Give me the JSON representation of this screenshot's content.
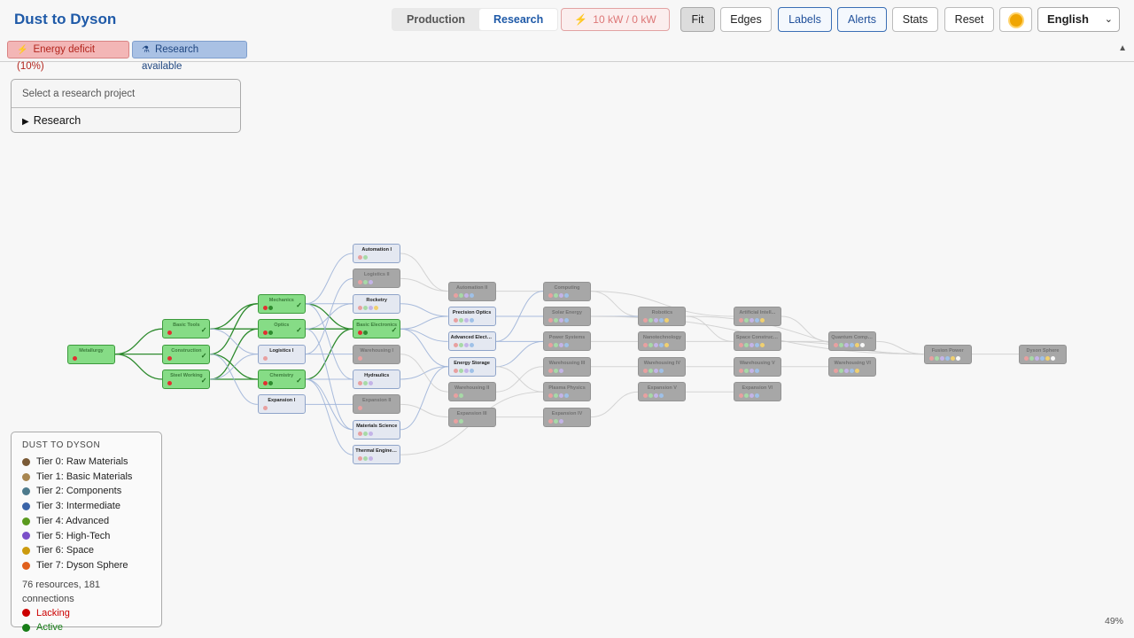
{
  "app": {
    "title": "Dust to Dyson"
  },
  "view_tabs": [
    {
      "label": "Production",
      "active": false
    },
    {
      "label": "Research",
      "active": true
    }
  ],
  "power": {
    "label": "10 kW / 0 kW"
  },
  "toolbar": {
    "fit": "Fit",
    "edges": "Edges",
    "labels": "Labels",
    "alerts": "Alerts",
    "stats": "Stats",
    "reset": "Reset"
  },
  "language": {
    "selected": "English"
  },
  "alerts": {
    "deficit": "Energy deficit (10%)",
    "research": "Research available"
  },
  "research_panel": {
    "placeholder": "Select a research project",
    "summary": "Research"
  },
  "legend": {
    "title": "DUST TO DYSON",
    "tiers": [
      {
        "label": "Tier 0: Raw Materials",
        "color": "#7a5a36"
      },
      {
        "label": "Tier 1: Basic Materials",
        "color": "#a88650"
      },
      {
        "label": "Tier 2: Components",
        "color": "#4d7a8c"
      },
      {
        "label": "Tier 3: Intermediate",
        "color": "#3a64a8"
      },
      {
        "label": "Tier 4: Advanced",
        "color": "#5a9a1e"
      },
      {
        "label": "Tier 5: High-Tech",
        "color": "#7b4fc9"
      },
      {
        "label": "Tier 6: Space",
        "color": "#cc9a0e"
      },
      {
        "label": "Tier 7: Dyson Sphere",
        "color": "#e0601c"
      }
    ],
    "stats": "76 resources, 181 connections",
    "lacking": {
      "label": "Lacking",
      "color": "#cc0000"
    },
    "active": {
      "label": "Active",
      "color": "#177d17"
    }
  },
  "zoom": "49%",
  "colors": {
    "accent": "#1f5aa8",
    "active_node": "#86dc86",
    "locked_node": "#a7a7a7",
    "available_node": "#e4e8f1"
  },
  "nodes": [
    {
      "id": "metallurgy",
      "label": "Metallurgy",
      "state": "active",
      "col": 0,
      "row": 4.0,
      "dots": [
        "#e03030"
      ],
      "check": false
    },
    {
      "id": "basic-tools",
      "label": "Basic Tools",
      "state": "active",
      "col": 1,
      "row": 3.0,
      "dots": [
        "#e03030"
      ],
      "check": true
    },
    {
      "id": "construction",
      "label": "Construction",
      "state": "active",
      "col": 1,
      "row": 4.0,
      "dots": [
        "#e03030"
      ],
      "check": true
    },
    {
      "id": "steel-working",
      "label": "Steel Working",
      "state": "active",
      "col": 1,
      "row": 5.0,
      "dots": [
        "#e03030"
      ],
      "check": true
    },
    {
      "id": "mechanics",
      "label": "Mechanics",
      "state": "active",
      "col": 2,
      "row": 2.0,
      "dots": [
        "#e03030",
        "#2e8b2e"
      ],
      "check": true
    },
    {
      "id": "optics",
      "label": "Optics",
      "state": "active",
      "col": 2,
      "row": 3.0,
      "dots": [
        "#e03030",
        "#2e8b2e"
      ],
      "check": true
    },
    {
      "id": "logistics-1",
      "label": "Logistics I",
      "state": "available",
      "col": 2,
      "row": 4.0,
      "dots": [
        "#e8a0a0"
      ],
      "check": false
    },
    {
      "id": "chemistry",
      "label": "Chemistry",
      "state": "active",
      "col": 2,
      "row": 5.0,
      "dots": [
        "#e03030",
        "#2e8b2e"
      ],
      "check": true
    },
    {
      "id": "expansion-1",
      "label": "Expansion I",
      "state": "available",
      "col": 2,
      "row": 6.0,
      "dots": [
        "#e8a0a0"
      ],
      "check": false
    },
    {
      "id": "automation-1",
      "label": "Automation I",
      "state": "available",
      "col": 3,
      "row": 0.0,
      "dots": [
        "#e8a0a0",
        "#a7d9a7"
      ],
      "check": false
    },
    {
      "id": "logistics-2",
      "label": "Logistics II",
      "state": "locked",
      "col": 3,
      "row": 1.0,
      "dots": [
        "#e8a0a0",
        "#a7d9a7",
        "#c4b4e8"
      ],
      "check": false
    },
    {
      "id": "rocketry",
      "label": "Rocketry",
      "state": "available",
      "col": 3,
      "row": 2.0,
      "dots": [
        "#e8a0a0",
        "#a7d9a7",
        "#c4b4e8",
        "#f0d070"
      ],
      "check": false
    },
    {
      "id": "basic-electronics",
      "label": "Basic Electronics",
      "state": "active",
      "col": 3,
      "row": 3.0,
      "dots": [
        "#e03030",
        "#2e8b2e"
      ],
      "check": true
    },
    {
      "id": "warehousing-1",
      "label": "Warehousing I",
      "state": "locked",
      "col": 3,
      "row": 4.0,
      "dots": [
        "#e8a0a0"
      ],
      "check": false
    },
    {
      "id": "hydraulics",
      "label": "Hydraulics",
      "state": "available",
      "col": 3,
      "row": 5.0,
      "dots": [
        "#e8a0a0",
        "#a7d9a7",
        "#c4b4e8"
      ],
      "check": false
    },
    {
      "id": "expansion-2",
      "label": "Expansion II",
      "state": "locked",
      "col": 3,
      "row": 6.0,
      "dots": [
        "#e8a0a0"
      ],
      "check": false
    },
    {
      "id": "materials-science",
      "label": "Materials Science",
      "state": "available",
      "col": 3,
      "row": 7.0,
      "dots": [
        "#e8a0a0",
        "#a7d9a7",
        "#c4b4e8"
      ],
      "check": false
    },
    {
      "id": "thermal-engineering",
      "label": "Thermal Engineeri...",
      "state": "available",
      "col": 3,
      "row": 8.0,
      "dots": [
        "#e8a0a0",
        "#a7d9a7",
        "#c4b4e8"
      ],
      "check": false
    },
    {
      "id": "automation-2",
      "label": "Automation II",
      "state": "locked",
      "col": 4,
      "row": 1.5,
      "dots": [
        "#e8a0a0",
        "#a7d9a7",
        "#c4b4e8",
        "#9fc1e8"
      ],
      "check": false
    },
    {
      "id": "precision-optics",
      "label": "Precision Optics",
      "state": "available",
      "col": 4,
      "row": 2.5,
      "dots": [
        "#e8a0a0",
        "#a7d9a7",
        "#c4b4e8",
        "#9fc1e8"
      ],
      "check": false
    },
    {
      "id": "advanced-electronics",
      "label": "Advanced Electron...",
      "state": "available",
      "col": 4,
      "row": 3.5,
      "dots": [
        "#e8a0a0",
        "#a7d9a7",
        "#c4b4e8",
        "#9fc1e8"
      ],
      "check": false
    },
    {
      "id": "energy-storage",
      "label": "Energy Storage",
      "state": "available",
      "col": 4,
      "row": 4.5,
      "dots": [
        "#e8a0a0",
        "#a7d9a7",
        "#c4b4e8",
        "#9fc1e8"
      ],
      "check": false
    },
    {
      "id": "warehousing-2",
      "label": "Warehousing II",
      "state": "locked",
      "col": 4,
      "row": 5.5,
      "dots": [
        "#e8a0a0",
        "#a7d9a7"
      ],
      "check": false
    },
    {
      "id": "expansion-3",
      "label": "Expansion III",
      "state": "locked",
      "col": 4,
      "row": 6.5,
      "dots": [
        "#e8a0a0",
        "#a7d9a7"
      ],
      "check": false
    },
    {
      "id": "computing",
      "label": "Computing",
      "state": "locked",
      "col": 5,
      "row": 1.5,
      "dots": [
        "#e8a0a0",
        "#a7d9a7",
        "#c4b4e8",
        "#9fc1e8"
      ],
      "check": false
    },
    {
      "id": "solar-energy",
      "label": "Solar Energy",
      "state": "locked",
      "col": 5,
      "row": 2.5,
      "dots": [
        "#e8a0a0",
        "#a7d9a7",
        "#c4b4e8",
        "#9fc1e8"
      ],
      "check": false
    },
    {
      "id": "power-systems",
      "label": "Power Systems",
      "state": "locked",
      "col": 5,
      "row": 3.5,
      "dots": [
        "#e8a0a0",
        "#a7d9a7",
        "#c4b4e8",
        "#9fc1e8"
      ],
      "check": false
    },
    {
      "id": "warehousing-3",
      "label": "Warehousing III",
      "state": "locked",
      "col": 5,
      "row": 4.5,
      "dots": [
        "#e8a0a0",
        "#a7d9a7",
        "#c4b4e8"
      ],
      "check": false
    },
    {
      "id": "plasma-physics",
      "label": "Plasma Physics",
      "state": "locked",
      "col": 5,
      "row": 5.5,
      "dots": [
        "#e8a0a0",
        "#a7d9a7",
        "#c4b4e8",
        "#9fc1e8"
      ],
      "check": false
    },
    {
      "id": "expansion-4",
      "label": "Expansion IV",
      "state": "locked",
      "col": 5,
      "row": 6.5,
      "dots": [
        "#e8a0a0",
        "#a7d9a7",
        "#c4b4e8"
      ],
      "check": false
    },
    {
      "id": "robotics",
      "label": "Robotics",
      "state": "locked",
      "col": 6,
      "row": 2.5,
      "dots": [
        "#e8a0a0",
        "#a7d9a7",
        "#c4b4e8",
        "#9fc1e8",
        "#f0d070"
      ],
      "check": false
    },
    {
      "id": "nanotechnology",
      "label": "Nanotechnology",
      "state": "locked",
      "col": 6,
      "row": 3.5,
      "dots": [
        "#e8a0a0",
        "#a7d9a7",
        "#c4b4e8",
        "#9fc1e8",
        "#f0d070"
      ],
      "check": false
    },
    {
      "id": "warehousing-4",
      "label": "Warehousing IV",
      "state": "locked",
      "col": 6,
      "row": 4.5,
      "dots": [
        "#e8a0a0",
        "#a7d9a7",
        "#c4b4e8",
        "#9fc1e8"
      ],
      "check": false
    },
    {
      "id": "expansion-5",
      "label": "Expansion V",
      "state": "locked",
      "col": 6,
      "row": 5.5,
      "dots": [
        "#e8a0a0",
        "#a7d9a7",
        "#c4b4e8",
        "#9fc1e8"
      ],
      "check": false
    },
    {
      "id": "artificial-intelligence",
      "label": "Artificial Intell...",
      "state": "locked",
      "col": 7,
      "row": 2.5,
      "dots": [
        "#e8a0a0",
        "#a7d9a7",
        "#c4b4e8",
        "#9fc1e8",
        "#f0d070"
      ],
      "check": false
    },
    {
      "id": "space-construction",
      "label": "Space Construction",
      "state": "locked",
      "col": 7,
      "row": 3.5,
      "dots": [
        "#e8a0a0",
        "#a7d9a7",
        "#c4b4e8",
        "#9fc1e8",
        "#f0d070"
      ],
      "check": false
    },
    {
      "id": "warehousing-5",
      "label": "Warehousing V",
      "state": "locked",
      "col": 7,
      "row": 4.5,
      "dots": [
        "#e8a0a0",
        "#a7d9a7",
        "#c4b4e8",
        "#9fc1e8"
      ],
      "check": false
    },
    {
      "id": "expansion-6",
      "label": "Expansion VI",
      "state": "locked",
      "col": 7,
      "row": 5.5,
      "dots": [
        "#e8a0a0",
        "#a7d9a7",
        "#c4b4e8",
        "#9fc1e8"
      ],
      "check": false
    },
    {
      "id": "quantum-computing",
      "label": "Quantum Computing",
      "state": "locked",
      "col": 8,
      "row": 3.5,
      "dots": [
        "#e8a0a0",
        "#a7d9a7",
        "#c4b4e8",
        "#9fc1e8",
        "#f0d070",
        "#f8f8f8"
      ],
      "check": false
    },
    {
      "id": "warehousing-6",
      "label": "Warehousing VI",
      "state": "locked",
      "col": 8,
      "row": 4.5,
      "dots": [
        "#e8a0a0",
        "#a7d9a7",
        "#c4b4e8",
        "#9fc1e8",
        "#f0d070"
      ],
      "check": false
    },
    {
      "id": "fusion-power",
      "label": "Fusion Power",
      "state": "locked",
      "col": 9,
      "row": 4.0,
      "dots": [
        "#e8a0a0",
        "#a7d9a7",
        "#c4b4e8",
        "#9fc1e8",
        "#f0d070",
        "#f8f8f8"
      ],
      "check": false
    },
    {
      "id": "dyson-sphere",
      "label": "Dyson Sphere",
      "state": "locked",
      "col": 10,
      "row": 4.0,
      "dots": [
        "#e8a0a0",
        "#a7d9a7",
        "#c4b4e8",
        "#9fc1e8",
        "#f0d070",
        "#f8f8f8"
      ],
      "check": false
    }
  ],
  "edges": [
    [
      "metallurgy",
      "basic-tools",
      "active"
    ],
    [
      "metallurgy",
      "construction",
      "active"
    ],
    [
      "metallurgy",
      "steel-working",
      "active"
    ],
    [
      "basic-tools",
      "mechanics",
      "active"
    ],
    [
      "basic-tools",
      "optics",
      "active"
    ],
    [
      "construction",
      "mechanics",
      "active"
    ],
    [
      "construction",
      "chemistry",
      "active"
    ],
    [
      "steel-working",
      "chemistry",
      "active"
    ],
    [
      "steel-working",
      "optics",
      "active"
    ],
    [
      "basic-tools",
      "logistics-1",
      "avail"
    ],
    [
      "construction",
      "expansion-1",
      "avail"
    ],
    [
      "steel-working",
      "logistics-1",
      "avail"
    ],
    [
      "optics",
      "basic-electronics",
      "active"
    ],
    [
      "chemistry",
      "basic-electronics",
      "active"
    ],
    [
      "mechanics",
      "basic-electronics",
      "active"
    ],
    [
      "mechanics",
      "automation-1",
      "avail"
    ],
    [
      "mechanics",
      "rocketry",
      "avail"
    ],
    [
      "optics",
      "rocketry",
      "avail"
    ],
    [
      "logistics-1",
      "logistics-2",
      "avail"
    ],
    [
      "chemistry",
      "hydraulics",
      "avail"
    ],
    [
      "chemistry",
      "materials-science",
      "avail"
    ],
    [
      "chemistry",
      "thermal-engineering",
      "avail"
    ],
    [
      "logistics-1",
      "warehousing-1",
      "avail"
    ],
    [
      "expansion-1",
      "expansion-2",
      "avail"
    ],
    [
      "mechanics",
      "hydraulics",
      "avail"
    ],
    [
      "optics",
      "materials-science",
      "avail"
    ],
    [
      "basic-electronics",
      "precision-optics",
      "avail"
    ],
    [
      "basic-electronics",
      "advanced-electronics",
      "avail"
    ],
    [
      "basic-electronics",
      "energy-storage",
      "avail"
    ],
    [
      "automation-1",
      "automation-2",
      "locked"
    ],
    [
      "rocketry",
      "precision-optics",
      "avail"
    ],
    [
      "hydraulics",
      "energy-storage",
      "avail"
    ],
    [
      "warehousing-1",
      "warehousing-2",
      "locked"
    ],
    [
      "expansion-2",
      "expansion-3",
      "locked"
    ],
    [
      "logistics-2",
      "automation-2",
      "locked"
    ],
    [
      "materials-science",
      "energy-storage",
      "avail"
    ],
    [
      "automation-2",
      "computing",
      "locked"
    ],
    [
      "precision-optics",
      "solar-energy",
      "avail"
    ],
    [
      "advanced-electronics",
      "computing",
      "avail"
    ],
    [
      "advanced-electronics",
      "power-systems",
      "avail"
    ],
    [
      "energy-storage",
      "power-systems",
      "avail"
    ],
    [
      "energy-storage",
      "plasma-physics",
      "locked"
    ],
    [
      "warehousing-2",
      "warehousing-3",
      "locked"
    ],
    [
      "expansion-3",
      "expansion-4",
      "locked"
    ],
    [
      "thermal-engineering",
      "plasma-physics",
      "locked"
    ],
    [
      "computing",
      "robotics",
      "locked"
    ],
    [
      "solar-energy",
      "robotics",
      "avail"
    ],
    [
      "power-systems",
      "nanotechnology",
      "locked"
    ],
    [
      "computing",
      "artificial-intelligence",
      "locked"
    ],
    [
      "warehousing-3",
      "warehousing-4",
      "locked"
    ],
    [
      "expansion-4",
      "expansion-5",
      "locked"
    ],
    [
      "robotics",
      "space-construction",
      "locked"
    ],
    [
      "nanotechnology",
      "space-construction",
      "locked"
    ],
    [
      "warehousing-4",
      "warehousing-5",
      "locked"
    ],
    [
      "expansion-5",
      "expansion-6",
      "locked"
    ],
    [
      "artificial-intelligence",
      "quantum-computing",
      "locked"
    ],
    [
      "space-construction",
      "quantum-computing",
      "locked"
    ],
    [
      "warehousing-5",
      "warehousing-6",
      "locked"
    ],
    [
      "quantum-computing",
      "fusion-power",
      "locked"
    ],
    [
      "space-construction",
      "fusion-power",
      "locked"
    ],
    [
      "robotics",
      "fusion-power",
      "locked"
    ],
    [
      "fusion-power",
      "dyson-sphere",
      "locked"
    ],
    [
      "solar-energy",
      "fusion-power",
      "locked"
    ]
  ]
}
